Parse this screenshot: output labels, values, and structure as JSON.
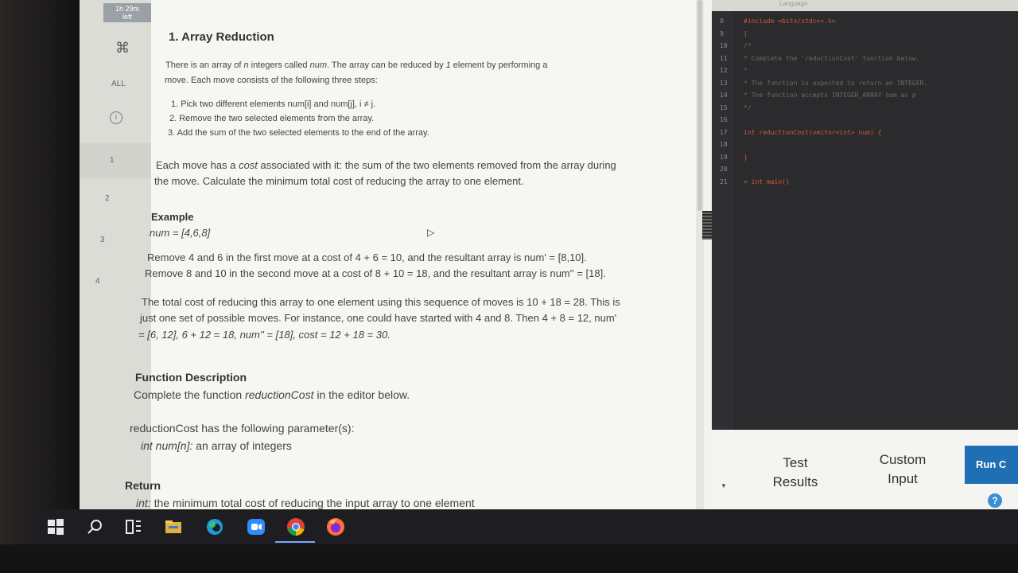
{
  "timer": {
    "line1": "1h 29m",
    "line2": "left"
  },
  "rail": {
    "cmd_icon": "⌘",
    "all_label": "ALL",
    "info_icon": "i",
    "questions": [
      "1",
      "2",
      "3",
      "4"
    ]
  },
  "problem": {
    "title": "1. Array Reduction",
    "intro_1a": "There is an array of ",
    "intro_n": "n",
    "intro_1b": " integers called ",
    "intro_num": "num",
    "intro_1c": ". The array can be reduced by ",
    "intro_one": "1",
    "intro_1d": " element by performing a",
    "intro_2": "move. Each move consists of the following three steps:",
    "step_1": "1. Pick two different elements num[i] and num[j], i ≠ j.",
    "step_2": "2. Remove the two selected elements from the array.",
    "step_3": "3. Add the sum of the two selected elements to the end of the array.",
    "cost_1a": "Each move has a ",
    "cost_word": "cost",
    "cost_1b": " associated with it: the sum of the two elements removed from the array during",
    "cost_2": "the move.  Calculate the minimum total cost of reducing the array to one element.",
    "example_head": "Example",
    "example_num": "num = [4,6,8]",
    "remove_1": "Remove 4 and 6 in the first move at a cost of 4 + 6 = 10, and the resultant array is num' = [8,10].",
    "remove_2": "Remove 8 and 10 in the second move at a cost of 8 + 10 = 18, and the resultant array is num'' = [18].",
    "total_1": "The total cost of reducing this array to one element using this sequence of moves is 10 + 18 = 28. This is",
    "total_2": "just one set of possible moves. For instance, one could have started with 4 and 8. Then 4 + 8 = 12, num'",
    "total_3": "= [6, 12], 6 + 12 = 18, num'' = [18], cost = 12 + 18 = 30.",
    "func_head": "Function Description",
    "func_desc_a": "Complete the function ",
    "func_name": "reductionCost",
    "func_desc_b": " in the editor below.",
    "params_head": "reductionCost has the following parameter(s):",
    "param_1a": "int num[n]:",
    "param_1b": " an array of integers",
    "return_head": "Return",
    "return_1a": "int:",
    "return_1b": " the minimum total cost of reducing the input array to one element"
  },
  "editor": {
    "language_label": "Language",
    "lines": [
      {
        "n": "8",
        "text": "#include <bits/stdc++.h>",
        "cls": "c-kw"
      },
      {
        "n": "9",
        "text": "[",
        "cls": "c-kw"
      },
      {
        "n": "10",
        "text": "/*",
        "cls": "c-cmt"
      },
      {
        "n": "11",
        "text": " * Complete the 'reductionCost' function below.",
        "cls": "c-cmt"
      },
      {
        "n": "12",
        "text": " *",
        "cls": "c-cmt"
      },
      {
        "n": "13",
        "text": " * The function is expected to return an INTEGER.",
        "cls": "c-cmt"
      },
      {
        "n": "14",
        "text": " * The function accepts INTEGER_ARRAY num as p",
        "cls": "c-cmt"
      },
      {
        "n": "15",
        "text": " */",
        "cls": "c-cmt"
      },
      {
        "n": "16",
        "text": "",
        "cls": "c-cmt"
      },
      {
        "n": "17",
        "text": "int reductionCost(vector<int> num) {",
        "cls": "c-kw"
      },
      {
        "n": "18",
        "text": "",
        "cls": "c-cmt"
      },
      {
        "n": "19",
        "text": "}",
        "cls": "c-kw"
      },
      {
        "n": "20",
        "text": "",
        "cls": "c-cmt"
      },
      {
        "n": "21",
        "text": "> int main()",
        "cls": "c-kw"
      }
    ]
  },
  "actions": {
    "test_results_1": "Test",
    "test_results_2": "Results",
    "custom_input_1": "Custom",
    "custom_input_2": "Input",
    "run_label": "Run C",
    "help_icon": "?"
  },
  "taskbar": {
    "icons": [
      "windows-start-icon",
      "search-icon",
      "task-view-icon",
      "file-explorer-icon",
      "edge-icon",
      "zoom-icon",
      "chrome-icon",
      "firefox-icon"
    ]
  }
}
